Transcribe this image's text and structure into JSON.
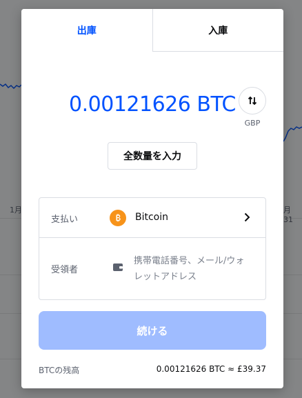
{
  "background": {
    "tick_left": "1月",
    "tick_right": "月 31"
  },
  "tabs": [
    {
      "label": "出庫",
      "active": true
    },
    {
      "label": "入庫",
      "active": false
    }
  ],
  "amount": {
    "value": "0.00121626 BTC",
    "switch_currency": "GBP"
  },
  "fill_button": {
    "label": "全数量を入力"
  },
  "form": {
    "payment": {
      "label": "支払い",
      "asset": "Bitcoin",
      "icon": "bitcoin-icon"
    },
    "recipient": {
      "label": "受領者",
      "placeholder": "携帯電話番号、メール/ウォレットアドレス",
      "icon": "wallet-icon"
    }
  },
  "continue_button": {
    "label": "続ける"
  },
  "balance": {
    "label": "BTCの残高",
    "value": "0.00121626 BTC ≈ £39.37"
  },
  "colors": {
    "accent": "#0052ff",
    "continue_disabled": "#9fbcff",
    "bitcoin": "#f7931a",
    "overlay": "rgba(10,11,13,0.5)"
  }
}
